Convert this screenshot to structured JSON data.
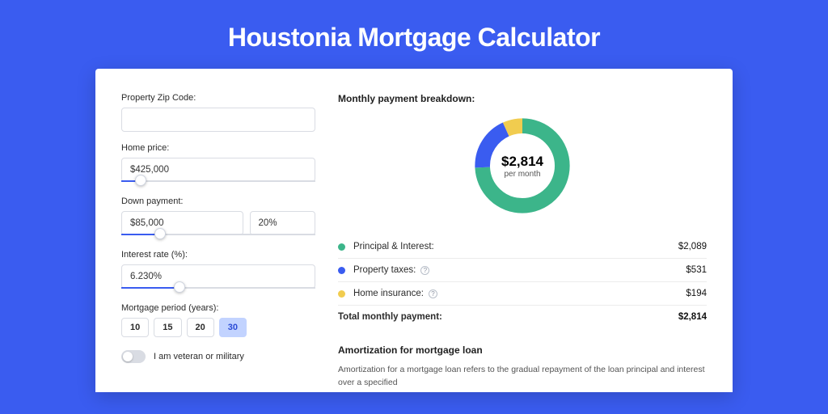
{
  "page_title": "Houstonia Mortgage Calculator",
  "colors": {
    "accent": "#3a5cf0",
    "green": "#3cb58a",
    "yellow": "#f1cc4f"
  },
  "form": {
    "zip": {
      "label": "Property Zip Code:",
      "value": ""
    },
    "home_price": {
      "label": "Home price:",
      "value": "$425,000",
      "slider_pct": 10
    },
    "down_payment": {
      "label": "Down payment:",
      "amount": "$85,000",
      "percent": "20%",
      "slider_pct": 20
    },
    "interest": {
      "label": "Interest rate (%):",
      "value": "6.230%",
      "slider_pct": 30
    },
    "period": {
      "label": "Mortgage period (years):",
      "options": [
        "10",
        "15",
        "20",
        "30"
      ],
      "active": "30"
    },
    "veteran": {
      "label": "I am veteran or military",
      "checked": false
    }
  },
  "breakdown": {
    "title": "Monthly payment breakdown:",
    "center_amount": "$2,814",
    "center_sub": "per month",
    "items": [
      {
        "color": "g",
        "label": "Principal & Interest:",
        "value": "$2,089",
        "share": 0.742,
        "help": false
      },
      {
        "color": "b",
        "label": "Property taxes:",
        "value": "$531",
        "share": 0.189,
        "help": true
      },
      {
        "color": "y",
        "label": "Home insurance:",
        "value": "$194",
        "share": 0.069,
        "help": true
      }
    ],
    "total": {
      "label": "Total monthly payment:",
      "value": "$2,814"
    }
  },
  "amortization": {
    "title": "Amortization for mortgage loan",
    "body": "Amortization for a mortgage loan refers to the gradual repayment of the loan principal and interest over a specified"
  },
  "chart_data": {
    "type": "pie",
    "title": "Monthly payment breakdown",
    "series": [
      {
        "name": "Principal & Interest",
        "value": 2089,
        "color": "#3cb58a"
      },
      {
        "name": "Property taxes",
        "value": 531,
        "color": "#3a5cf0"
      },
      {
        "name": "Home insurance",
        "value": 194,
        "color": "#f1cc4f"
      }
    ],
    "total": 2814,
    "unit": "USD per month"
  }
}
